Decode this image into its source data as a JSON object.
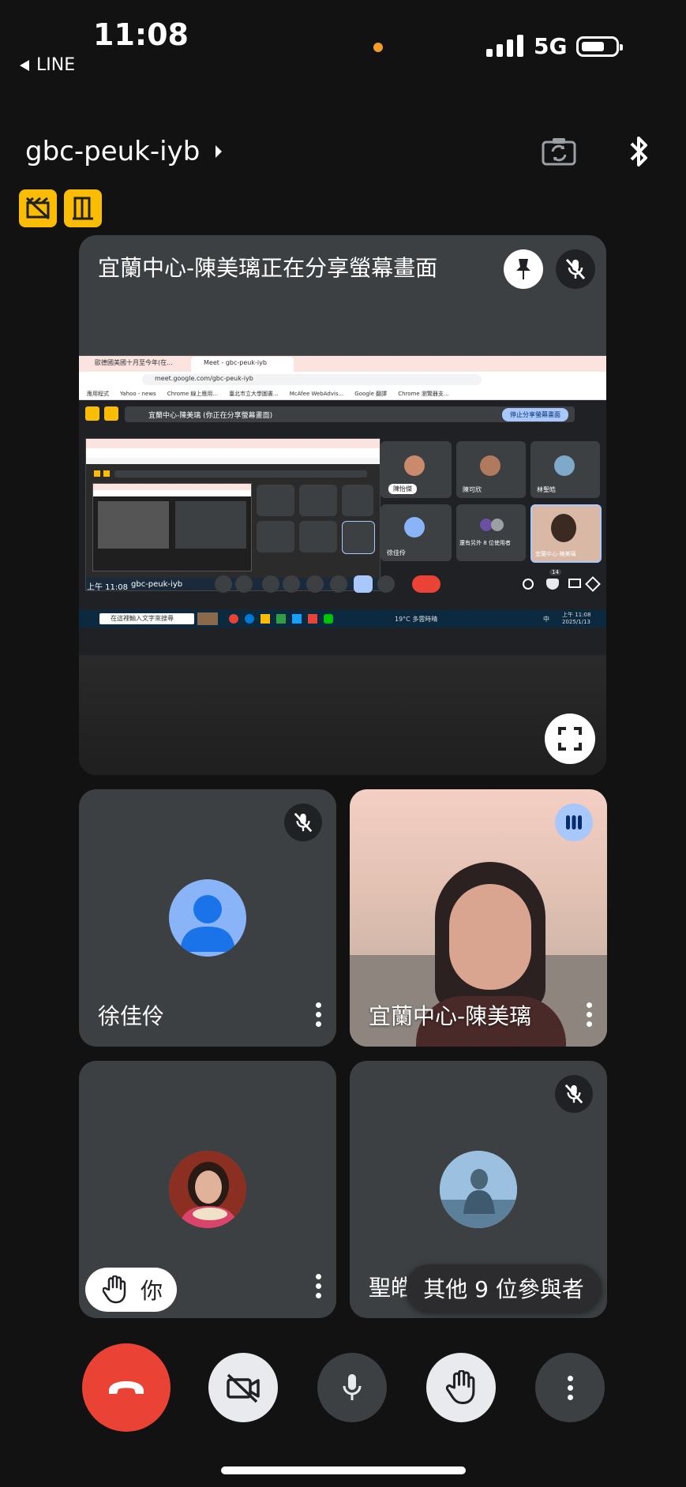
{
  "status_bar": {
    "time": "11:08",
    "back_app": "LINE",
    "network": "5G"
  },
  "header": {
    "meeting_code": "gbc-peuk-iyb"
  },
  "share_tile": {
    "title": "宜蘭中心-陳美璃正在分享螢幕畫面",
    "inner": {
      "tab1": "歐德國美國十月至今年(在...",
      "tab2": "Meet - gbc-peuk-iyb",
      "url": "meet.google.com/gbc-peuk-iyb",
      "bookmarks": [
        "應用程式",
        "Yahoo - news",
        "Chrome 線上應用...",
        "臺北市立大學圖書...",
        "McAfee WebAdvis...",
        "Google 翻譯",
        "Chrome 瀏覽器支..."
      ],
      "share_banner": "宜蘭中心-陳美璃 (你正在分享螢幕畫面)",
      "stop_share": "停止分享螢幕畫面",
      "participants": [
        {
          "name": "陳怡傑"
        },
        {
          "name": "陳可欣"
        },
        {
          "name": "林聖皓"
        },
        {
          "name": "徐佳伶"
        },
        {
          "name": "還有另外 8 位使用者"
        },
        {
          "name": "宜蘭中心-陳美璃"
        }
      ],
      "bottom_time": "上午 11:08",
      "bottom_code": "gbc-peuk-iyb",
      "participant_count": "14",
      "taskbar_search": "在這裡輸入文字來搜尋",
      "weather": "19°C 多雲時晴",
      "taskbar_lang": "中",
      "taskbar_time": "上午 11:08",
      "taskbar_date": "2025/1/13"
    }
  },
  "tiles": [
    {
      "name": "徐佳伶"
    },
    {
      "name": "宜蘭中心-陳美璃"
    },
    {
      "name": "你"
    },
    {
      "name": "聖皓"
    }
  ],
  "others_pill": "其他 9 位參與者",
  "colors": {
    "end_call": "#ea4335",
    "raise_hand_badge": "#fbbc04",
    "avatar_blue": "#8ab4f8",
    "speaking": "#a8c7fa"
  }
}
